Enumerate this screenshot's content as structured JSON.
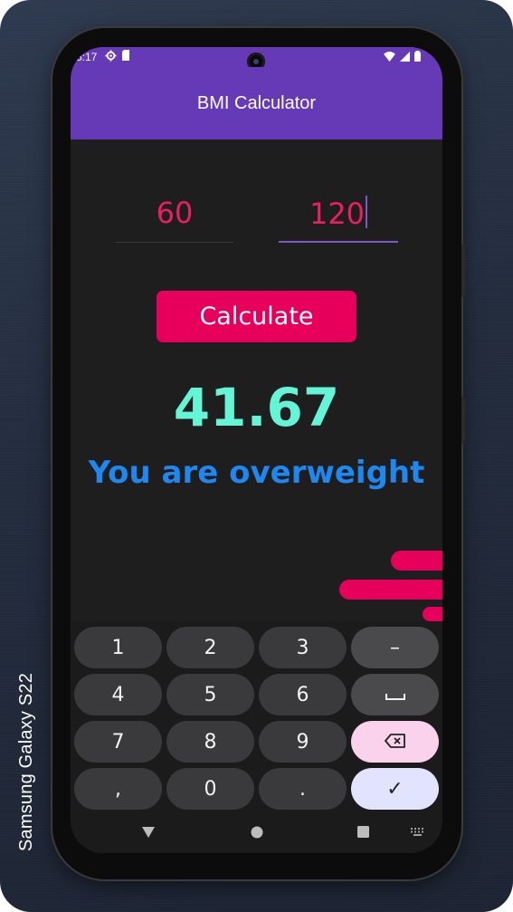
{
  "device": {
    "label": "Samsung Galaxy  S22"
  },
  "status_bar": {
    "time": "5:17"
  },
  "app": {
    "title": "BMI Calculator"
  },
  "inputs": {
    "weight": {
      "value": "60"
    },
    "height": {
      "value": "120"
    }
  },
  "actions": {
    "calculate_label": "Calculate"
  },
  "result": {
    "bmi": "41.67",
    "message": "You are overweight"
  },
  "colors": {
    "appbar": "#663ab7",
    "accent_pink": "#e6005c",
    "input_text": "#e91e63",
    "bmi_value": "#64f5d7",
    "message": "#1e88f0",
    "background": "#1e1e1f"
  },
  "keyboard": {
    "rows": [
      [
        "1",
        "2",
        "3",
        "–"
      ],
      [
        "4",
        "5",
        "6",
        "␣"
      ],
      [
        "7",
        "8",
        "9",
        "backspace"
      ],
      [
        ",",
        "0",
        ".",
        "✓"
      ]
    ]
  },
  "icons": {
    "status_left": [
      "settings-icon",
      "sim-icon"
    ],
    "status_right": [
      "wifi-icon",
      "signal-icon",
      "battery-icon"
    ],
    "nav": [
      "back-icon",
      "home-icon",
      "recents-icon",
      "keyboard-icon"
    ]
  }
}
